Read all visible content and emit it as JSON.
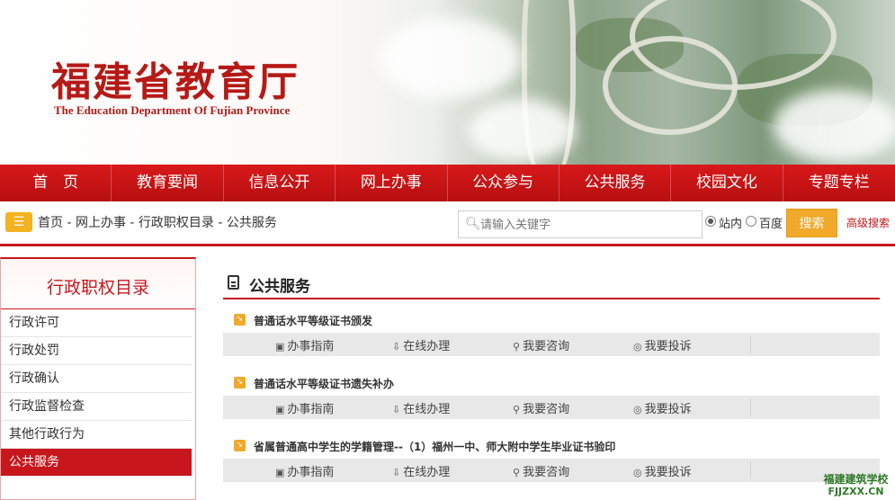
{
  "header": {
    "title_cn": "福建省教育厅",
    "title_en": "The Education Department Of Fujian Province"
  },
  "nav": {
    "items": [
      {
        "label": "首　页"
      },
      {
        "label": "教育要闻"
      },
      {
        "label": "信息公开"
      },
      {
        "label": "网上办事"
      },
      {
        "label": "公众参与"
      },
      {
        "label": "公共服务"
      },
      {
        "label": "校园文化"
      },
      {
        "label": "专题专栏"
      }
    ]
  },
  "breadcrumb": {
    "items": [
      "首页",
      "网上办事",
      "行政职权目录",
      "公共服务"
    ],
    "separator": " - "
  },
  "search": {
    "placeholder": "请输入关键字",
    "option_site": "站内",
    "option_baidu": "百度",
    "selected": "站内",
    "button_label": "搜索",
    "advanced_label": "高级搜索"
  },
  "sidebar": {
    "title": "行政职权目录",
    "items": [
      {
        "label": "行政许可"
      },
      {
        "label": "行政处罚"
      },
      {
        "label": "行政确认"
      },
      {
        "label": "行政监督检查"
      },
      {
        "label": "其他行政行为"
      },
      {
        "label": "公共服务",
        "active": true
      }
    ]
  },
  "main": {
    "title": "公共服务",
    "entries": [
      {
        "title": "普通话水平等级证书颁发"
      },
      {
        "title": "普通话水平等级证书遗失补办"
      },
      {
        "title": "省属普通高中学生的学籍管理--（1）福州一中、师大附中学生毕业证书验印"
      }
    ],
    "actions": {
      "guide": "办事指南",
      "online": "在线办理",
      "consult": "我要咨询",
      "complain": "我要投诉"
    }
  },
  "watermark": {
    "cn": "福建建筑学校",
    "en": "FJJZXX.CN"
  },
  "colors": {
    "brand_red": "#c8161d",
    "nav_red": "#d8191a",
    "accent_orange": "#f0a92a"
  }
}
